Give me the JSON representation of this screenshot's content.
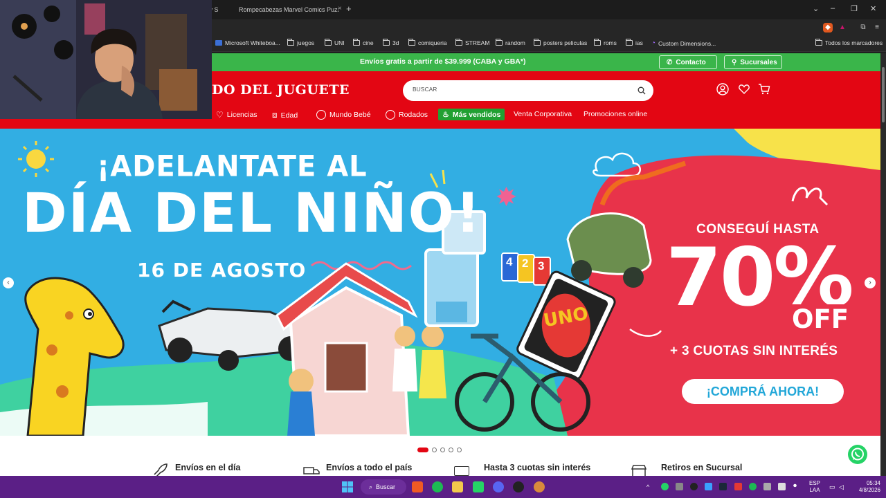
{
  "browser": {
    "tabs": [
      {
        "label": "ty S"
      },
      {
        "label": "Rompecabezas Marvel Comics Puzzle"
      }
    ],
    "bookmarks": [
      {
        "label": "Microsoft Whiteboa..."
      },
      {
        "label": "juegos"
      },
      {
        "label": "UNI"
      },
      {
        "label": "cine"
      },
      {
        "label": "3d"
      },
      {
        "label": "comiqueria"
      },
      {
        "label": "STREAM"
      },
      {
        "label": "random"
      },
      {
        "label": "posters peliculas"
      },
      {
        "label": "roms"
      },
      {
        "label": "ias"
      },
      {
        "label": "Custom Dimensions..."
      },
      {
        "label": "Todos los marcadores"
      }
    ]
  },
  "site": {
    "promo": "Envíos gratis a partir de $39.999 (CABA y GBA*)",
    "contact_label": "Contacto",
    "branches_label": "Sucursales",
    "logo": "DO DEL JUGUETE",
    "search_placeholder": "BUSCAR",
    "nav": [
      {
        "label": "Licencias"
      },
      {
        "label": "Edad"
      },
      {
        "label": "Mundo Bebé"
      },
      {
        "label": "Rodados"
      },
      {
        "label": "Más vendidos"
      },
      {
        "label": "Venta Corporativa"
      },
      {
        "label": "Promociones online"
      }
    ],
    "hero": {
      "line1": "¡ADELANTATE AL",
      "line2": "DÍA DEL NIÑO!",
      "date": "16 DE AGOSTO",
      "offer_line1": "CONSEGUÍ HASTA",
      "offer_pct": "70%",
      "offer_off": "OFF",
      "offer_cuotas": "+ 3 CUOTAS SIN INTERÉS",
      "cta": "¡COMPRÁ AHORA!",
      "uno": "UNO",
      "cards": [
        "4",
        "2",
        "3"
      ]
    },
    "slides": {
      "count": 5,
      "active": 0
    },
    "features": [
      {
        "label": "Envíos en el día"
      },
      {
        "label": "Envíos a todo el país"
      },
      {
        "label": "Hasta 3 cuotas sin interés"
      },
      {
        "label": "Retiros en Sucursal"
      }
    ]
  },
  "taskbar": {
    "search_label": "Buscar",
    "lang_line1": "ESP",
    "lang_line2": "LAA",
    "time": "05:34",
    "date": "4/8/2026"
  },
  "colors": {
    "brand_red": "#e30613",
    "promo_green": "#3ab54a",
    "taskbar": "#5b1f86"
  }
}
